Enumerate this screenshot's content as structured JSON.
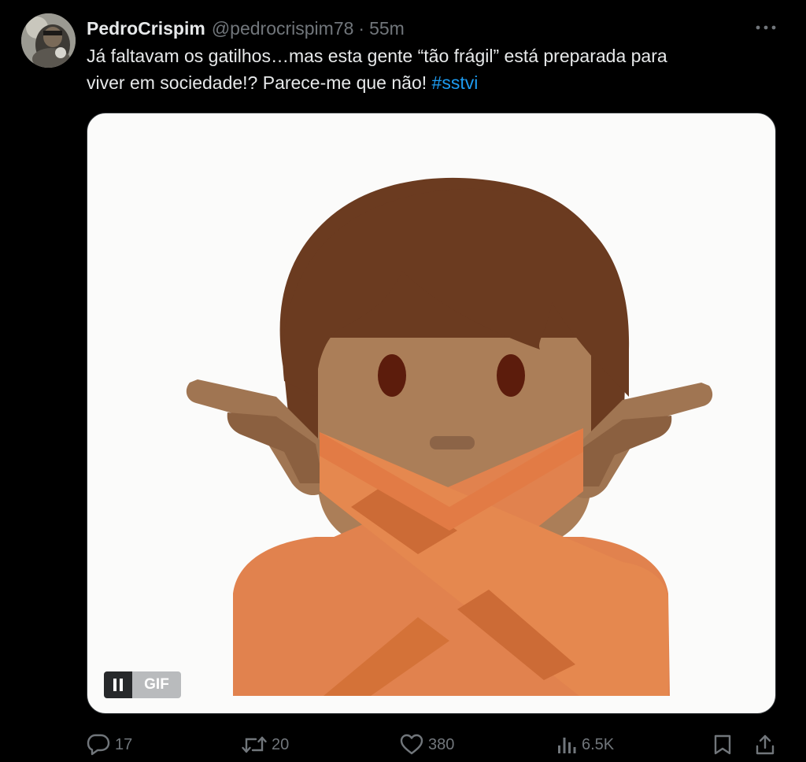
{
  "author": {
    "display_name": "PedroCrispim",
    "handle": "@pedrocrispim78",
    "separator": "·",
    "timestamp": "55m"
  },
  "tweet": {
    "text_line1": "Já faltavam os gatilhos…mas esta gente “tão frágil” está preparada para",
    "text_line2": "viver em sociedade!? Parece-me que não! ",
    "hashtag": "#sstvi"
  },
  "media": {
    "type": "gif",
    "gif_badge": "GIF",
    "content_icon": "person-gesturing-no-emoji"
  },
  "actions": {
    "replies": "17",
    "reposts": "20",
    "likes": "380",
    "views": "6.5K"
  },
  "colors": {
    "background": "#000000",
    "text": "#e7e9ea",
    "muted": "#71767b",
    "link": "#1d9bf0"
  }
}
